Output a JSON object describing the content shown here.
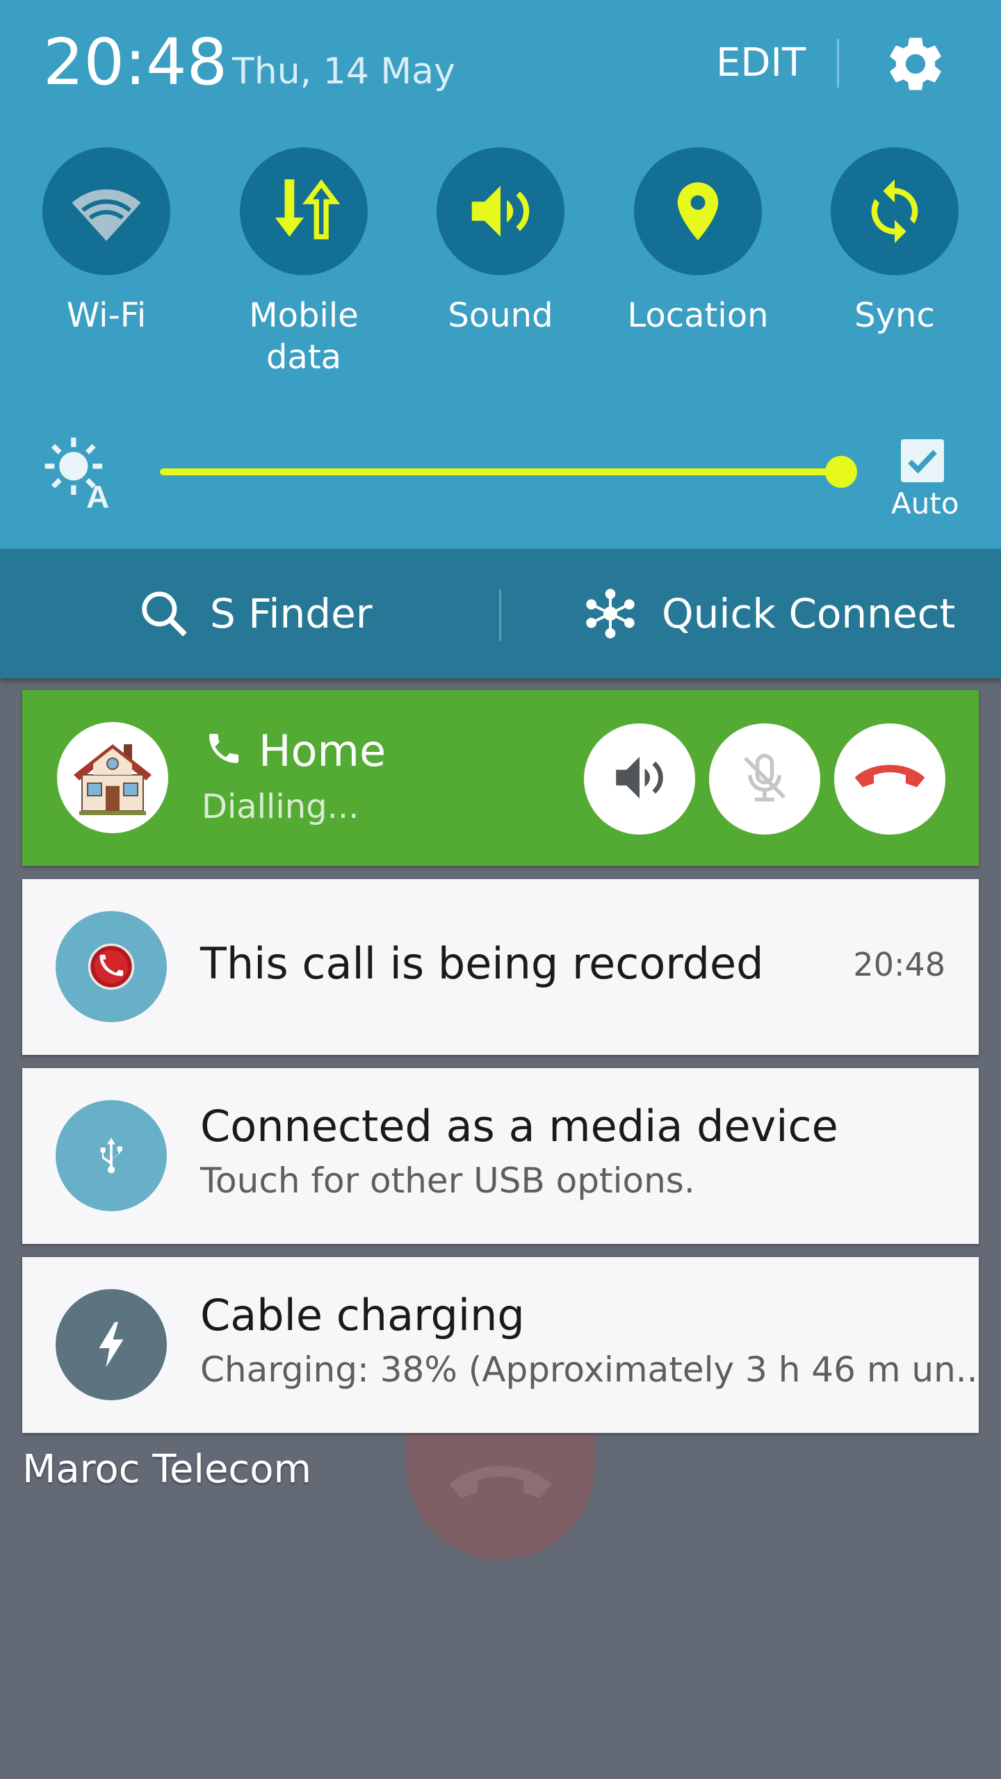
{
  "status": {
    "time": "20:48",
    "date": "Thu, 14 May"
  },
  "header": {
    "edit_label": "EDIT"
  },
  "toggles": [
    {
      "label": "Wi-Fi",
      "icon": "wifi-icon",
      "active": false
    },
    {
      "label": "Mobile\ndata",
      "icon": "mobile-data-icon",
      "active": true
    },
    {
      "label": "Sound",
      "icon": "sound-icon",
      "active": true
    },
    {
      "label": "Location",
      "icon": "location-icon",
      "active": true
    },
    {
      "label": "Sync",
      "icon": "sync-icon",
      "active": true
    }
  ],
  "brightness": {
    "level": 1.0,
    "auto_label": "Auto",
    "auto_checked": true
  },
  "finder": {
    "s_finder_label": "S Finder",
    "quick_connect_label": "Quick Connect"
  },
  "call": {
    "contact": "Home",
    "status": "Dialling..."
  },
  "notifications": {
    "recording": {
      "title": "This call is being recorded",
      "time": "20:48"
    },
    "usb": {
      "title": "Connected as a media device",
      "subtitle": "Touch for other USB options."
    },
    "charging": {
      "title": "Cable charging",
      "subtitle": "Charging: 38% (Approximately 3 h 46 m un.."
    }
  },
  "background": {
    "carrier": "Maroc Telecom"
  },
  "colors": {
    "panel": "#3a9fc2",
    "toggle_bg": "#146f94",
    "accent": "#e6f81c",
    "finder_bar": "#277896",
    "call_card": "#54ab34",
    "end_call": "#e2463f"
  }
}
